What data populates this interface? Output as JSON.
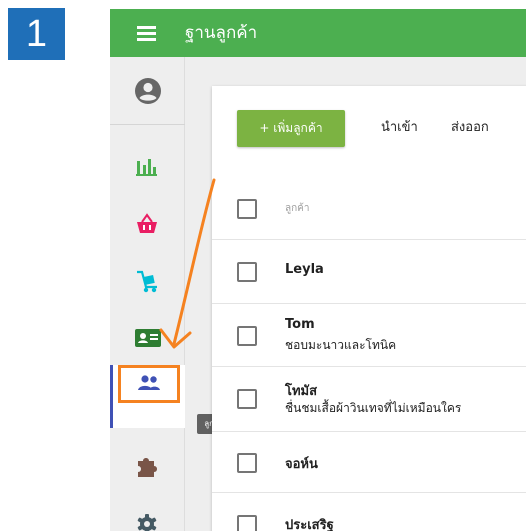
{
  "step_number": "1",
  "app": {
    "title": "ฐานลูกค้า",
    "accent_color": "#4caf50"
  },
  "sidebar": {
    "items": [
      {
        "icon": "account-circle-icon",
        "color": "#666666"
      },
      {
        "icon": "bar-chart-icon",
        "color": "#4caf50"
      },
      {
        "icon": "shopping-basket-icon",
        "color": "#e91e63"
      },
      {
        "icon": "dolly-cart-icon",
        "color": "#00bcd4"
      },
      {
        "icon": "id-card-icon",
        "color": "#2e7d32"
      },
      {
        "icon": "people-icon",
        "color": "#3f51b5",
        "active": true,
        "tooltip": "ลูกค้า"
      },
      {
        "icon": "puzzle-icon",
        "color": "#795548"
      },
      {
        "icon": "gear-icon",
        "color": "#455a64"
      }
    ]
  },
  "toolbar": {
    "add_label": "+ เพิ่มลูกค้า",
    "import_label": "นำเข้า",
    "export_label": "ส่งออก"
  },
  "table": {
    "header": "ลูกค้า",
    "rows": [
      {
        "name": "Leyla",
        "note": ""
      },
      {
        "name": "Tom",
        "note": "ชอบมะนาวและโทนิค"
      },
      {
        "name": "โทมัส",
        "note": "ชื่นชมเสื้อผ้าวินเทจที่ไม่เหมือนใคร"
      },
      {
        "name": "จอห์น",
        "note": ""
      },
      {
        "name": "ประเสริฐ",
        "note": ""
      }
    ]
  },
  "annotation": {
    "highlight_color": "#f58220",
    "badge_color": "#1f6fb8"
  }
}
